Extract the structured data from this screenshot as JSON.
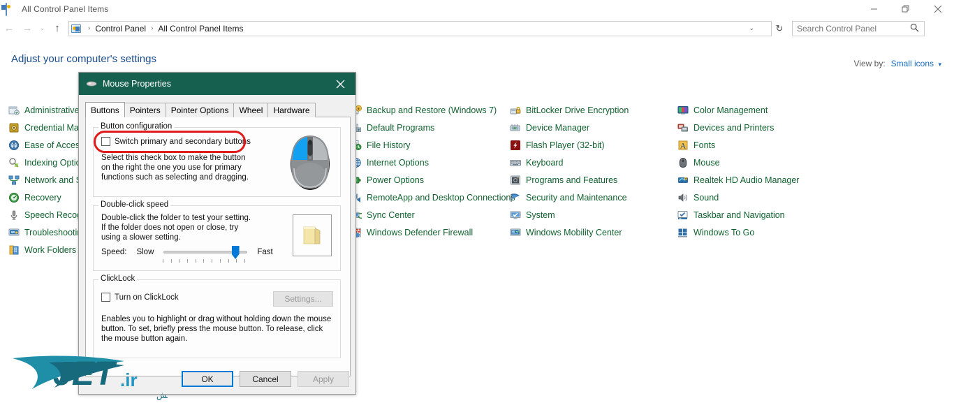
{
  "window": {
    "title": "All Control Panel Items",
    "icon": "control-panel-icon",
    "minimize": "—",
    "restore": "❐",
    "close": "✕"
  },
  "address_bar": {
    "back": "←",
    "forward": "→",
    "recent": "⌄",
    "up": "↑",
    "crumbs": [
      "Control Panel",
      "All Control Panel Items"
    ],
    "separator": "›",
    "dropdown": "⌄",
    "refresh": "↻"
  },
  "search": {
    "placeholder": "Search Control Panel",
    "value": "",
    "icon": "search-icon"
  },
  "page": {
    "heading": "Adjust your computer's settings",
    "view_by_label": "View by:",
    "view_by_value": "Small icons",
    "view_by_caret": "▾"
  },
  "items": {
    "col0": [
      {
        "label": "Administrative Tools",
        "icon": "administrative-tools-icon"
      },
      {
        "label": "Credential Manager",
        "icon": "credential-manager-icon"
      },
      {
        "label": "Ease of Access Center",
        "icon": "ease-of-access-icon"
      },
      {
        "label": "Indexing Options",
        "icon": "indexing-options-icon"
      },
      {
        "label": "Network and Sharing Center",
        "icon": "network-sharing-icon"
      },
      {
        "label": "Recovery",
        "icon": "recovery-icon"
      },
      {
        "label": "Speech Recognition",
        "icon": "speech-recognition-icon"
      },
      {
        "label": "Troubleshooting",
        "icon": "troubleshooting-icon"
      },
      {
        "label": "Work Folders",
        "icon": "work-folders-icon"
      }
    ],
    "col1": [
      {
        "label": "Backup and Restore (Windows 7)",
        "icon": "backup-restore-icon"
      },
      {
        "label": "Default Programs",
        "icon": "default-programs-icon"
      },
      {
        "label": "File History",
        "icon": "file-history-icon"
      },
      {
        "label": "Internet Options",
        "icon": "internet-options-icon"
      },
      {
        "label": "Power Options",
        "icon": "power-options-icon"
      },
      {
        "label": "RemoteApp and Desktop Connections",
        "icon": "remoteapp-icon"
      },
      {
        "label": "Sync Center",
        "icon": "sync-center-icon"
      },
      {
        "label": "Windows Defender Firewall",
        "icon": "defender-firewall-icon"
      }
    ],
    "col2": [
      {
        "label": "BitLocker Drive Encryption",
        "icon": "bitlocker-icon"
      },
      {
        "label": "Device Manager",
        "icon": "device-manager-icon"
      },
      {
        "label": "Flash Player (32-bit)",
        "icon": "flash-player-icon"
      },
      {
        "label": "Keyboard",
        "icon": "keyboard-icon"
      },
      {
        "label": "Programs and Features",
        "icon": "programs-features-icon"
      },
      {
        "label": "Security and Maintenance",
        "icon": "security-maintenance-icon"
      },
      {
        "label": "System",
        "icon": "system-icon"
      },
      {
        "label": "Windows Mobility Center",
        "icon": "mobility-center-icon"
      }
    ],
    "col3": [
      {
        "label": "Color Management",
        "icon": "color-management-icon"
      },
      {
        "label": "Devices and Printers",
        "icon": "devices-printers-icon"
      },
      {
        "label": "Fonts",
        "icon": "fonts-icon"
      },
      {
        "label": "Mouse",
        "icon": "mouse-icon"
      },
      {
        "label": "Realtek HD Audio Manager",
        "icon": "realtek-audio-icon"
      },
      {
        "label": "Sound",
        "icon": "sound-icon"
      },
      {
        "label": "Taskbar and Navigation",
        "icon": "taskbar-navigation-icon"
      },
      {
        "label": "Windows To Go",
        "icon": "windows-to-go-icon"
      }
    ]
  },
  "dialog": {
    "title": "Mouse Properties",
    "icon": "mouse-icon",
    "close": "✕",
    "tabs": [
      {
        "label": "Buttons",
        "active": true
      },
      {
        "label": "Pointers",
        "active": false
      },
      {
        "label": "Pointer Options",
        "active": false
      },
      {
        "label": "Wheel",
        "active": false
      },
      {
        "label": "Hardware",
        "active": false
      }
    ],
    "button_configuration": {
      "group_title": "Button configuration",
      "checkbox_label": "Switch primary and secondary buttons",
      "checkbox_checked": false,
      "description": "Select this check box to make the button on the right the one you use for primary functions such as selecting and dragging.",
      "highlight_color": "#e01b1b"
    },
    "double_click_speed": {
      "group_title": "Double-click speed",
      "description": "Double-click the folder to test your setting. If the folder does not open or close, try using a slower setting.",
      "speed_label": "Speed:",
      "slow_label": "Slow",
      "fast_label": "Fast",
      "slider_percent": 88
    },
    "click_lock": {
      "group_title": "ClickLock",
      "checkbox_label": "Turn on ClickLock",
      "checkbox_checked": false,
      "settings_button": "Settings...",
      "settings_disabled": true,
      "description": "Enables you to highlight or drag without holding down the mouse button. To set, briefly press the mouse button. To release, click the mouse button again."
    },
    "footer": {
      "ok": "OK",
      "cancel": "Cancel",
      "apply": "Apply",
      "apply_disabled": true
    }
  },
  "watermark": {
    "brand": "JET",
    "tld": ".ir",
    "tagline": "جت ، پرواز در آسمان دانش",
    "color": "#1f7f90"
  },
  "colors": {
    "dialog_titlebar": "#16604f",
    "item_text": "#11612f",
    "heading": "#1b4d8e",
    "accent_blue": "#0078d7",
    "link_blue": "#1b6ec2"
  }
}
